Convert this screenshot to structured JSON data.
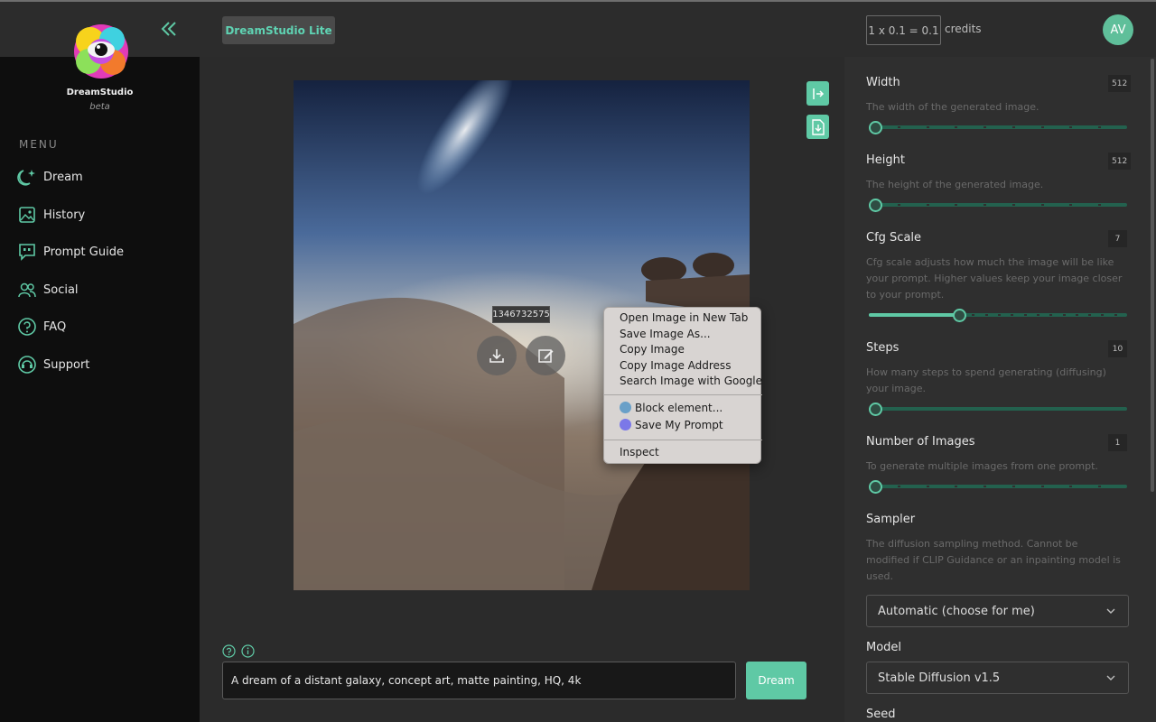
{
  "app": {
    "brand_name": "DreamStudio",
    "brand_beta": "beta",
    "brand_tab": "DreamStudio Lite"
  },
  "credits": {
    "cost": "1 x 0.1 = 0.1",
    "label": "credits"
  },
  "user": {
    "initials": "AV"
  },
  "menu": {
    "title": "MENU",
    "items": [
      {
        "label": "Dream",
        "icon": "moon-sparkle-icon"
      },
      {
        "label": "History",
        "icon": "image-gallery-icon"
      },
      {
        "label": "Prompt Guide",
        "icon": "quote-bubble-icon"
      },
      {
        "label": "Social",
        "icon": "users-icon"
      },
      {
        "label": "FAQ",
        "icon": "question-circle-icon"
      },
      {
        "label": "Support",
        "icon": "support-headset-icon"
      }
    ]
  },
  "image": {
    "seed": "1346732575"
  },
  "context_menu": {
    "items": [
      "Open Image in New Tab",
      "Save Image As...",
      "Copy Image",
      "Copy Image Address",
      "Search Image with Google",
      "Block element...",
      "Save My Prompt",
      "Inspect"
    ]
  },
  "prompt": {
    "value": "A dream of a distant galaxy, concept art, matte painting, HQ, 4k",
    "button": "Dream"
  },
  "settings": {
    "width": {
      "title": "Width",
      "value": "512",
      "desc": "The width of the generated image.",
      "level": 0
    },
    "height": {
      "title": "Height",
      "value": "512",
      "desc": "The height of the generated image.",
      "level": 0
    },
    "cfg": {
      "title": "Cfg Scale",
      "value": "7",
      "desc": "Cfg scale adjusts how much the image will be like your prompt. Higher values keep your image closer to your prompt.",
      "level": 0.35
    },
    "steps": {
      "title": "Steps",
      "value": "10",
      "desc": "How many steps to spend generating (diffusing) your image.",
      "level": 0
    },
    "num_images": {
      "title": "Number of Images",
      "value": "1",
      "desc": "To generate multiple images from one prompt.",
      "level": 0
    },
    "sampler": {
      "title": "Sampler",
      "desc": "The diffusion sampling method. Cannot be modified if CLIP Guidance or an inpainting model is used.",
      "selected": "Automatic (choose for me)"
    },
    "model": {
      "title": "Model",
      "selected": "Stable Diffusion v1.5"
    },
    "seed": {
      "title": "Seed"
    }
  },
  "colors": {
    "accent": "#5fc9a5",
    "sidebar_bg": "#0e0e0e",
    "panel_bg": "#2f2f2f"
  }
}
